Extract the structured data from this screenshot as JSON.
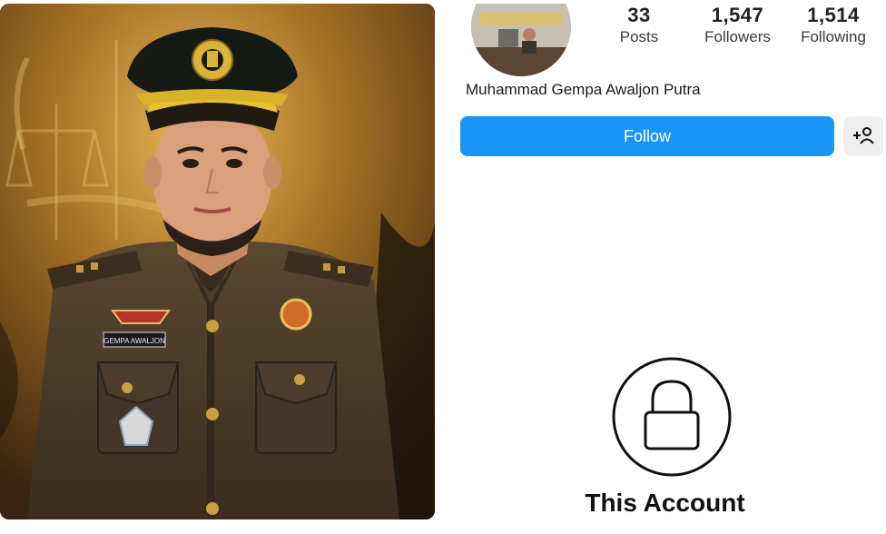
{
  "photo": {
    "name_tag": "GEMPA AWALJON"
  },
  "profile": {
    "stats": [
      {
        "value": "33",
        "label": "Posts"
      },
      {
        "value": "1,547",
        "label": "Followers"
      },
      {
        "value": "1,514",
        "label": "Following"
      }
    ],
    "display_name": "Muhammad Gempa Awaljon Putra",
    "follow_label": "Follow",
    "add_user_icon": "add-person-icon",
    "private_notice": "This Account",
    "lock_icon": "lock-icon"
  },
  "colors": {
    "follow_button": "#1a95f5",
    "uniform": "#4a3a26",
    "background_gold": "#b9862e"
  }
}
